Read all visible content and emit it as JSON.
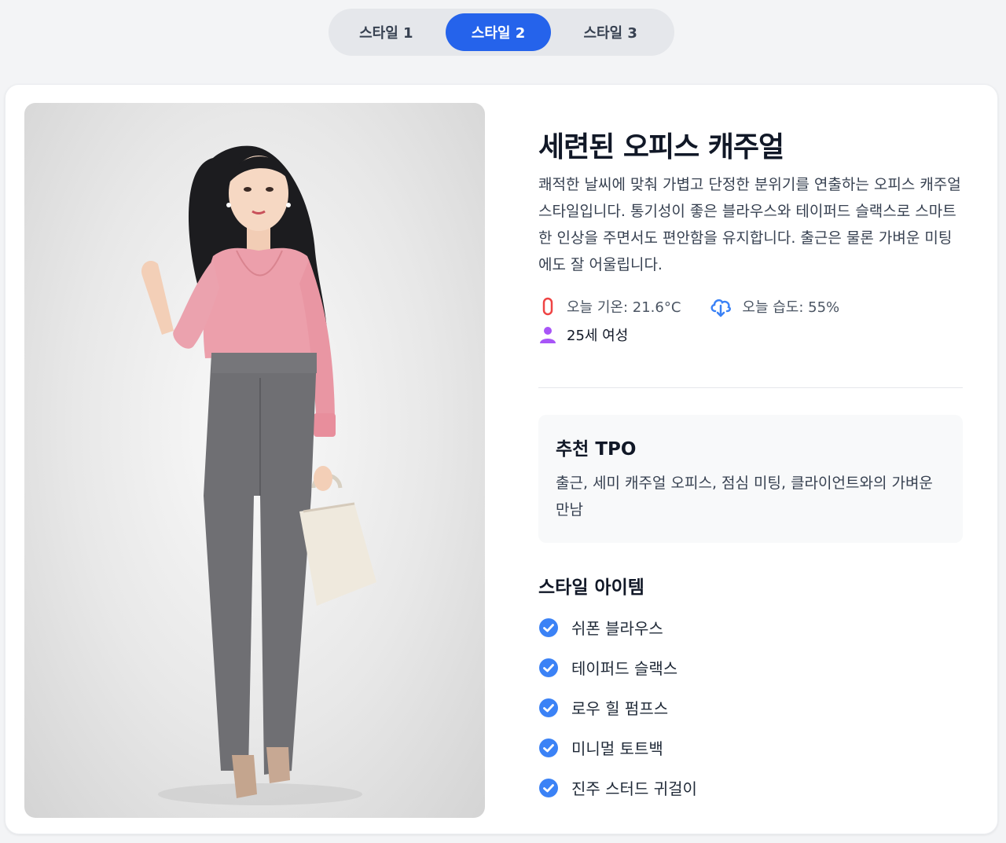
{
  "tabs": [
    {
      "label": "스타일 1",
      "active": false
    },
    {
      "label": "스타일 2",
      "active": true
    },
    {
      "label": "스타일 3",
      "active": false
    }
  ],
  "style": {
    "title": "세련된 오피스 캐주얼",
    "description": "쾌적한 날씨에 맞춰 가볍고 단정한 분위기를 연출하는 오피스 캐주얼 스타일입니다. 통기성이 좋은 블라우스와 테이퍼드 슬랙스로 스마트한 인상을 주면서도 편안함을 유지합니다. 출근은 물론 가벼운 미팅에도 잘 어울립니다.",
    "temperature": "오늘 기온: 21.6°C",
    "humidity": "오늘 습도: 55%",
    "person": "25세 여성"
  },
  "tpo": {
    "title": "추천 TPO",
    "text": "출근, 세미 캐주얼 오피스, 점심 미팅, 클라이언트와의 가벼운 만남"
  },
  "items": {
    "title": "스타일 아이템",
    "list": [
      "쉬폰 블라우스",
      "테이퍼드 슬랙스",
      "로우 힐 펌프스",
      "미니멀 토트백",
      "진주 스터드 귀걸이"
    ]
  },
  "colors": {
    "accent": "#2563eb",
    "thermometer": "#ef4444",
    "humidity": "#3b82f6",
    "person": "#a855f7",
    "check": "#3b82f6"
  },
  "icons": {
    "temperature": "thermometer-icon",
    "humidity": "cloud-download-icon",
    "person": "person-icon",
    "check": "check-circle-icon"
  },
  "image": {
    "alt": "fashion illustration of woman in pink blouse and grey slacks"
  }
}
